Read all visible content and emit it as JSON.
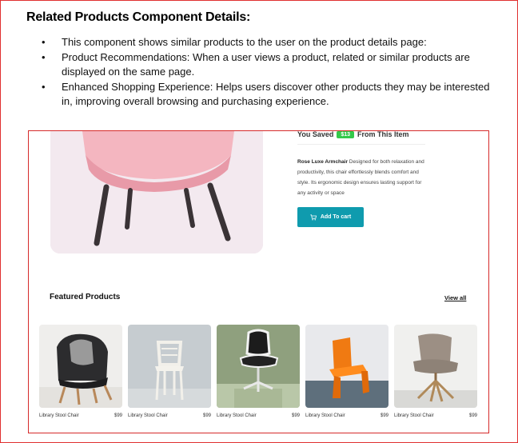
{
  "document": {
    "heading": "Related Products Component Details:",
    "bullets": [
      "This component shows similar products to the user on the product details page:",
      "Product Recommendations: When a user views a product, related or similar products are displayed on the same page.",
      "Enhanced Shopping Experience: Helps users discover other products they may be interested in, improving overall browsing and purchasing experience."
    ],
    "bullet_glyph": "•"
  },
  "screenshot": {
    "saved_prefix": "You Saved",
    "saved_amount": "$13",
    "saved_suffix": "From This Item",
    "product_name": "Rose Luxe Armchair",
    "product_description": "Designed for both relaxation and productivity, this chair effortlessly blends comfort and style. Its ergonomic design ensures lasting support for any activity or space",
    "add_to_cart": "Add To cart",
    "cart_icon": "cart-icon",
    "featured_title": "Featured Products",
    "view_all": "View all",
    "colors": {
      "accent": "#0f9bae",
      "saved_badge": "#33c94a",
      "frame": "#e03030"
    },
    "products": [
      {
        "name": "Library Stool Chair",
        "price": "$99"
      },
      {
        "name": "Library Stool Chair",
        "price": "$99"
      },
      {
        "name": "Library Stool Chair",
        "price": "$99"
      },
      {
        "name": "Library Stool Chair",
        "price": "$99"
      },
      {
        "name": "Library Stool Chair",
        "price": "$99"
      }
    ]
  }
}
